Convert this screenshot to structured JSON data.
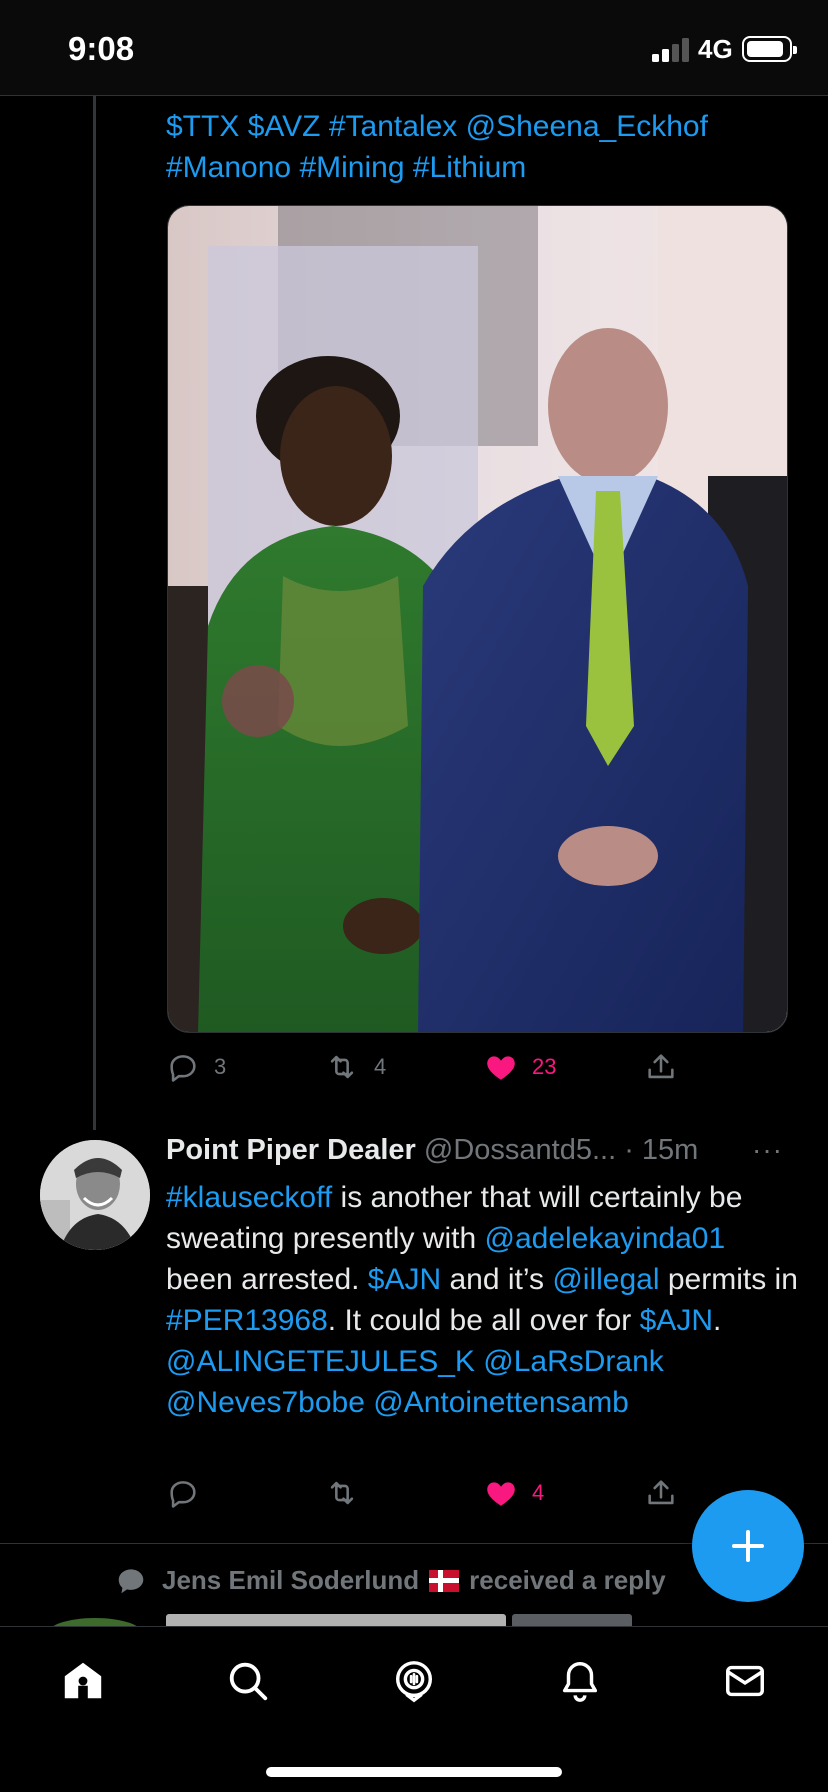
{
  "status_bar": {
    "time": "9:08",
    "network": "4G"
  },
  "tweet1": {
    "text_segments": [
      {
        "text": "$TTX",
        "link": true
      },
      {
        "text": " ",
        "link": false
      },
      {
        "text": "$AVZ",
        "link": true
      },
      {
        "text": " ",
        "link": false
      },
      {
        "text": "#Tantalex",
        "link": true
      },
      {
        "text": " ",
        "link": false
      },
      {
        "text": "@Sheena_Eckhof",
        "link": true
      },
      {
        "text": " ",
        "link": false
      },
      {
        "text": "#Manono",
        "link": true
      },
      {
        "text": " ",
        "link": false
      },
      {
        "text": "#Mining",
        "link": true
      },
      {
        "text": " ",
        "link": false
      },
      {
        "text": "#Lithium",
        "link": true
      }
    ],
    "replies": "3",
    "retweets": "4",
    "likes": "23",
    "liked": true
  },
  "tweet2": {
    "name": "Point Piper Dealer",
    "handle": "@Dossantd5...",
    "time": "· 15m",
    "more": "···",
    "text_segments": [
      {
        "text": "#klauseckoff",
        "link": true
      },
      {
        "text": " is another that will certainly be sweating presently with ",
        "link": false
      },
      {
        "text": "@adelekayinda01",
        "link": true
      },
      {
        "text": " been arrested. ",
        "link": false
      },
      {
        "text": "$AJN",
        "link": true
      },
      {
        "text": " and it’s ",
        "link": false
      },
      {
        "text": "@illegal",
        "link": true
      },
      {
        "text": " permits in ",
        "link": false
      },
      {
        "text": "#PER13968",
        "link": true
      },
      {
        "text": ". It could be all over for ",
        "link": false
      },
      {
        "text": "$AJN",
        "link": true
      },
      {
        "text": ". ",
        "link": false
      },
      {
        "text": "@ALINGETEJULES_K",
        "link": true
      },
      {
        "text": " ",
        "link": false
      },
      {
        "text": "@LaRsDrank",
        "link": true
      },
      {
        "text": " ",
        "link": false
      },
      {
        "text": "@Neves7bobe",
        "link": true
      },
      {
        "text": " ",
        "link": false
      },
      {
        "text": "@Antoinettensamb",
        "link": true
      }
    ],
    "likes": "4",
    "liked": true
  },
  "reply_note": {
    "name": "Jens Emil Soderlund",
    "suffix": "received a reply"
  },
  "colors": {
    "accent": "#1d9bf0",
    "like": "#f91880",
    "muted": "#71767b",
    "background": "#000000"
  },
  "icons": {
    "reply": "reply-icon",
    "retweet": "retweet-icon",
    "like": "heart-icon",
    "share": "share-icon",
    "compose": "plus-icon",
    "home": "home-icon",
    "search": "search-icon",
    "spaces": "spaces-icon",
    "notifications": "bell-icon",
    "messages": "mail-icon"
  }
}
